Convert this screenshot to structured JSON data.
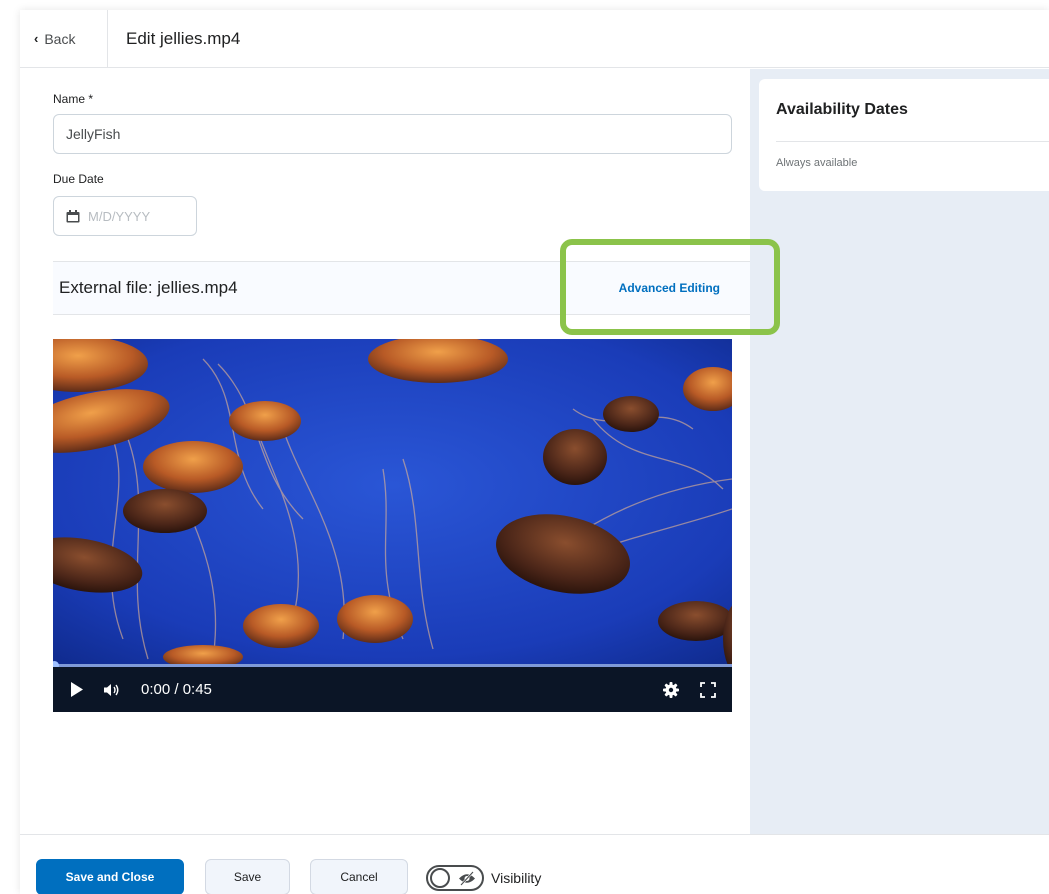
{
  "header": {
    "back_label": "Back",
    "title": "Edit jellies.mp4"
  },
  "form": {
    "name_label": "Name *",
    "name_value": "JellyFish",
    "due_date_label": "Due Date",
    "due_date_placeholder": "M/D/YYYY",
    "file_title": "External file: jellies.mp4",
    "advanced_editing_label": "Advanced Editing"
  },
  "video": {
    "time": "0:00 / 0:45",
    "progress_fraction": 0.0
  },
  "availability": {
    "title": "Availability Dates",
    "status": "Always available"
  },
  "footer": {
    "save_close_label": "Save and Close",
    "save_label": "Save",
    "cancel_label": "Cancel",
    "visibility_label": "Visibility"
  },
  "colors": {
    "primary": "#006fbf",
    "highlight": "#8bc34a",
    "panel_bg": "#e7edf5",
    "video_bg": "#1b3fbf"
  },
  "icons": {
    "back": "chevron-left-icon",
    "calendar": "calendar-icon",
    "play": "play-icon",
    "volume": "volume-icon",
    "settings": "gear-icon",
    "fullscreen": "fullscreen-icon",
    "visibility": "eye-off-icon"
  }
}
